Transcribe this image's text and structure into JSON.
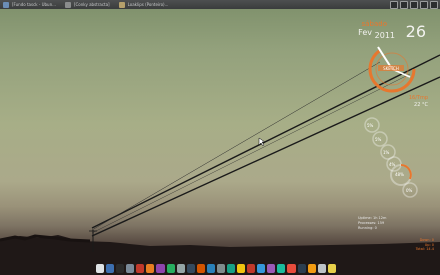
{
  "taskbar": {
    "tasks": [
      {
        "label": "[Fundo tasck - Ubun..."
      },
      {
        "label": "[Conky abstracta]"
      },
      {
        "label": "Loaklips (Ponteiro)..."
      }
    ]
  },
  "widgets": {
    "day_name": "sábado",
    "month": "Fev",
    "year": "2011",
    "day_number": "26",
    "clock_label": "SKETCH",
    "temperature_label": "16/Tmp",
    "temperature": "22 °C",
    "gauges": [
      {
        "label": "5%",
        "level": 0.05
      },
      {
        "label": "5%",
        "level": 0.05
      },
      {
        "label": "1%",
        "level": 0.01
      },
      {
        "label": "4%",
        "level": 0.04
      },
      {
        "label": "48%",
        "level": 0.48
      },
      {
        "label": "0%",
        "level": 0.0
      }
    ],
    "sysinfo": [
      "Uptime: 1h 12m",
      "Processes: 159",
      "Running: 0"
    ],
    "netinfo": [
      "Down: 0",
      "Up: 0",
      "Total: 14.4"
    ]
  },
  "colors": {
    "accent": "#e7772e",
    "text": "#f2f2ef"
  },
  "dock": {
    "icons": [
      "home-icon",
      "browser-icon",
      "terminal-icon",
      "files-icon",
      "mail-icon",
      "music-icon",
      "chat-icon",
      "photos-icon",
      "settings-icon",
      "editor-icon",
      "calendar-icon",
      "network-icon",
      "trash-icon",
      "app-icon",
      "app-icon",
      "app-icon",
      "app-icon",
      "app-icon",
      "app-icon",
      "app-icon",
      "app-icon",
      "app-icon",
      "app-icon",
      "app-icon"
    ]
  }
}
